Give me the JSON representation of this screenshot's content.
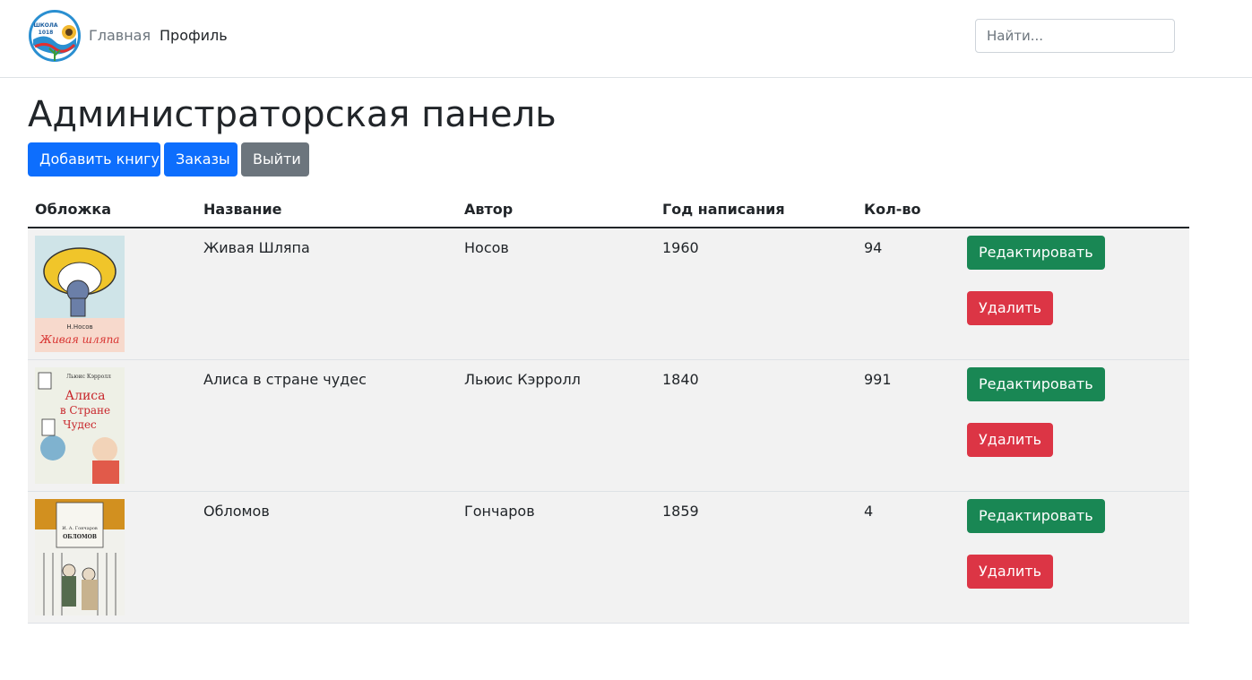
{
  "nav": {
    "logo_text": "ШКОЛА 1018",
    "home": "Главная",
    "profile": "Профиль",
    "search_placeholder": "Найти..."
  },
  "page": {
    "title": "Администраторская панель",
    "add_book": "Добавить книгу",
    "orders": "Заказы",
    "logout": "Выйти"
  },
  "table": {
    "headers": {
      "cover": "Обложка",
      "name": "Название",
      "author": "Автор",
      "year": "Год написания",
      "qty": "Кол-во"
    },
    "edit_label": "Редактировать",
    "delete_label": "Удалить",
    "rows": [
      {
        "name": "Живая Шляпа",
        "author": "Носов",
        "year": "1960",
        "qty": "94",
        "cover_text": "Н.Носов",
        "cover_title": "Живая шляпа"
      },
      {
        "name": "Алиса в стране чудес",
        "author": "Льюис Кэрролл",
        "year": "1840",
        "qty": "991",
        "cover_text": "Льюис Кэрролл",
        "cover_title": "Алиса в Стране Чудес"
      },
      {
        "name": "Обломов",
        "author": "Гончаров",
        "year": "1859",
        "qty": "4",
        "cover_text": "И. А. Гончаров",
        "cover_title": "ОБЛОМОВ"
      }
    ]
  },
  "colors": {
    "primary": "#0d6efd",
    "secondary": "#6c757d",
    "success": "#198754",
    "danger": "#dc3545",
    "row_bg": "#f2f2f2"
  }
}
